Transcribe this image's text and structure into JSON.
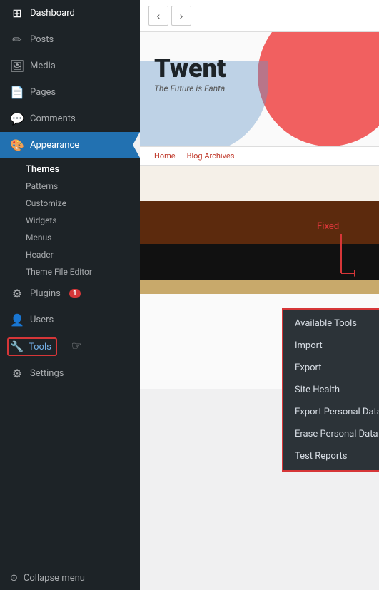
{
  "sidebar": {
    "items": [
      {
        "id": "dashboard",
        "label": "Dashboard",
        "icon": "⊞",
        "active": false
      },
      {
        "id": "posts",
        "label": "Posts",
        "icon": "✏",
        "active": false
      },
      {
        "id": "media",
        "label": "Media",
        "icon": "⊟",
        "active": false
      },
      {
        "id": "pages",
        "label": "Pages",
        "icon": "☰",
        "active": false
      },
      {
        "id": "comments",
        "label": "Comments",
        "icon": "💬",
        "active": false
      },
      {
        "id": "appearance",
        "label": "Appearance",
        "icon": "🎨",
        "active": true
      },
      {
        "id": "plugins",
        "label": "Plugins",
        "icon": "⚙",
        "active": false,
        "badge": "1"
      },
      {
        "id": "users",
        "label": "Users",
        "icon": "👤",
        "active": false
      },
      {
        "id": "tools",
        "label": "Tools",
        "icon": "🔧",
        "active": false
      },
      {
        "id": "settings",
        "label": "Settings",
        "icon": "⚙",
        "active": false
      }
    ],
    "appearance_submenu": [
      {
        "id": "themes",
        "label": "Themes",
        "bold": true
      },
      {
        "id": "patterns",
        "label": "Patterns"
      },
      {
        "id": "customize",
        "label": "Customize"
      },
      {
        "id": "widgets",
        "label": "Widgets"
      },
      {
        "id": "menus",
        "label": "Menus"
      },
      {
        "id": "header",
        "label": "Header"
      },
      {
        "id": "theme-file-editor",
        "label": "Theme File Editor"
      }
    ],
    "collapse_label": "Collapse menu"
  },
  "preview": {
    "nav": {
      "back_label": "‹",
      "forward_label": "›"
    },
    "theme": {
      "title": "Twent",
      "subtitle": "The Future is Fanta",
      "nav_links": [
        "Home",
        "Blog Archives"
      ]
    },
    "fixed_label": "Fixed",
    "arrow": "↓"
  },
  "dropdown": {
    "items": [
      {
        "id": "available-tools",
        "label": "Available Tools"
      },
      {
        "id": "import",
        "label": "Import"
      },
      {
        "id": "export",
        "label": "Export"
      },
      {
        "id": "site-health",
        "label": "Site Health"
      },
      {
        "id": "export-personal-data",
        "label": "Export Personal Data"
      },
      {
        "id": "erase-personal-data",
        "label": "Erase Personal Data"
      },
      {
        "id": "test-reports",
        "label": "Test Reports"
      }
    ]
  }
}
